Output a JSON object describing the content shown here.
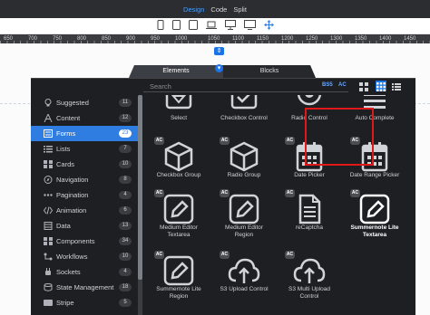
{
  "topbar": {
    "tabs": [
      {
        "label": "Design"
      },
      {
        "label": "Code"
      },
      {
        "label": "Split"
      }
    ],
    "active_color": "#46a0ff"
  },
  "devices": [
    "mobile-icon",
    "tablet-icon",
    "tablet-landscape-icon",
    "laptop-icon",
    "desktop-icon",
    "monitor-icon",
    "move-icon"
  ],
  "ruler": {
    "marks": [
      "650",
      "700",
      "750",
      "800",
      "850",
      "900",
      "950",
      "1000",
      "1050",
      "1100",
      "1150",
      "1200",
      "1250",
      "1300",
      "1350",
      "1400",
      "1450"
    ]
  },
  "panel": {
    "tabs": [
      {
        "label": "Elements"
      },
      {
        "label": "Blocks"
      }
    ],
    "search_placeholder": "Search",
    "toggles": [
      "BS5",
      "AC"
    ],
    "accent": "#2f7de0"
  },
  "sidebar": {
    "items": [
      {
        "label": "Suggested",
        "count": "11",
        "icon": "lightbulb-icon"
      },
      {
        "label": "Content",
        "count": "12",
        "icon": "text-icon"
      },
      {
        "label": "Forms",
        "count": "23",
        "icon": "forms-icon",
        "active": true
      },
      {
        "label": "Lists",
        "count": "7",
        "icon": "list-icon"
      },
      {
        "label": "Cards",
        "count": "10",
        "icon": "card-icon"
      },
      {
        "label": "Navigation",
        "count": "8",
        "icon": "compass-icon"
      },
      {
        "label": "Pagination",
        "count": "4",
        "icon": "pagination-icon"
      },
      {
        "label": "Animation",
        "count": "6",
        "icon": "code-icon"
      },
      {
        "label": "Data",
        "count": "13",
        "icon": "data-icon"
      },
      {
        "label": "Components",
        "count": "34",
        "icon": "components-icon"
      },
      {
        "label": "Workflows",
        "count": "10",
        "icon": "workflows-icon"
      },
      {
        "label": "Sockets",
        "count": "4",
        "icon": "sockets-icon"
      },
      {
        "label": "State Management",
        "count": "18",
        "icon": "state-icon"
      },
      {
        "label": "Stripe",
        "count": "5",
        "icon": "stripe-icon"
      }
    ]
  },
  "components": [
    {
      "label1": "Select",
      "label2": "",
      "icon": "select-icon",
      "ac": false
    },
    {
      "label1": "Checkbox Control",
      "label2": "",
      "icon": "checkbox-icon",
      "ac": false
    },
    {
      "label1": "Radio Control",
      "label2": "",
      "icon": "radio-icon",
      "ac": false
    },
    {
      "label1": "Auto Complete",
      "label2": "",
      "icon": "autocomplete-icon",
      "ac": false
    },
    {
      "label1": "Checkbox Group",
      "label2": "",
      "icon": "cube-icon",
      "ac": true
    },
    {
      "label1": "Radio Group",
      "label2": "",
      "icon": "cube-icon",
      "ac": true
    },
    {
      "label1": "Date Picker",
      "label2": "",
      "icon": "calendar-icon",
      "ac": true
    },
    {
      "label1": "Date Range Picker",
      "label2": "",
      "icon": "calendar-icon",
      "ac": true
    },
    {
      "label1": "Medium Editor",
      "label2": "Textarea",
      "icon": "pencil-icon",
      "ac": true
    },
    {
      "label1": "Medium Editor",
      "label2": "Region",
      "icon": "pencil-icon",
      "ac": true
    },
    {
      "label1": "reCaptcha",
      "label2": "",
      "icon": "document-icon",
      "ac": true
    },
    {
      "label1": "Summernote Lite",
      "label2": "Textarea",
      "icon": "pencil-icon",
      "ac": true,
      "selected": true
    },
    {
      "label1": "Summernote Lite",
      "label2": "Region",
      "icon": "pencil-icon",
      "ac": true
    },
    {
      "label1": "S3 Upload Control",
      "label2": "",
      "icon": "cloud-upload-icon",
      "ac": true
    },
    {
      "label1": "S3 Multi Upload",
      "label2": "Control",
      "icon": "cloud-upload-icon",
      "ac": true
    },
    {
      "label1": "",
      "label2": "",
      "icon": "",
      "ac": false
    }
  ]
}
